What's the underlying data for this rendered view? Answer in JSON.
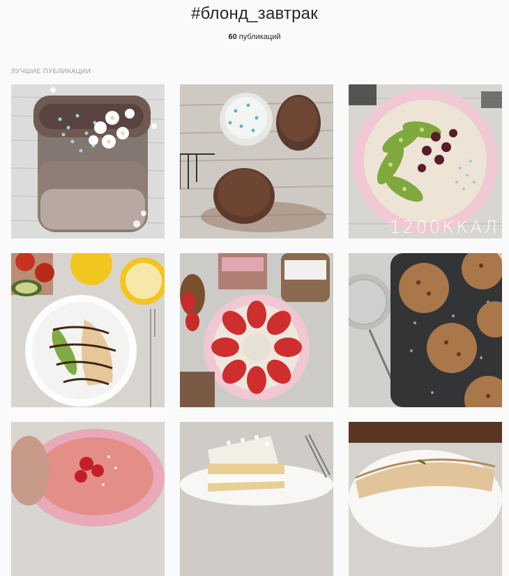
{
  "header": {
    "hashtag": "#блонд_завтрак",
    "post_count_number": "60",
    "post_count_suffix": " публикаций"
  },
  "top_posts": {
    "label": "Лучшие публикации",
    "tiles": [
      {
        "alt": "chocolate smoothie jar with flowers"
      },
      {
        "alt": "cupcakes on wooden table"
      },
      {
        "alt": "pink bowl with kiwi and berries",
        "overlay": "1200ККАЛ"
      },
      {
        "alt": "pancake with avocado and chocolate sauce"
      },
      {
        "alt": "oatmeal bowl with strawberries"
      },
      {
        "alt": "muffins in baking tray"
      },
      {
        "alt": "pink smoothie bowl with raspberries"
      },
      {
        "alt": "coconut cake slice"
      },
      {
        "alt": "crepe roll"
      }
    ]
  },
  "colors": {
    "background": "#fafafa",
    "text": "#262626",
    "muted": "#999999"
  }
}
